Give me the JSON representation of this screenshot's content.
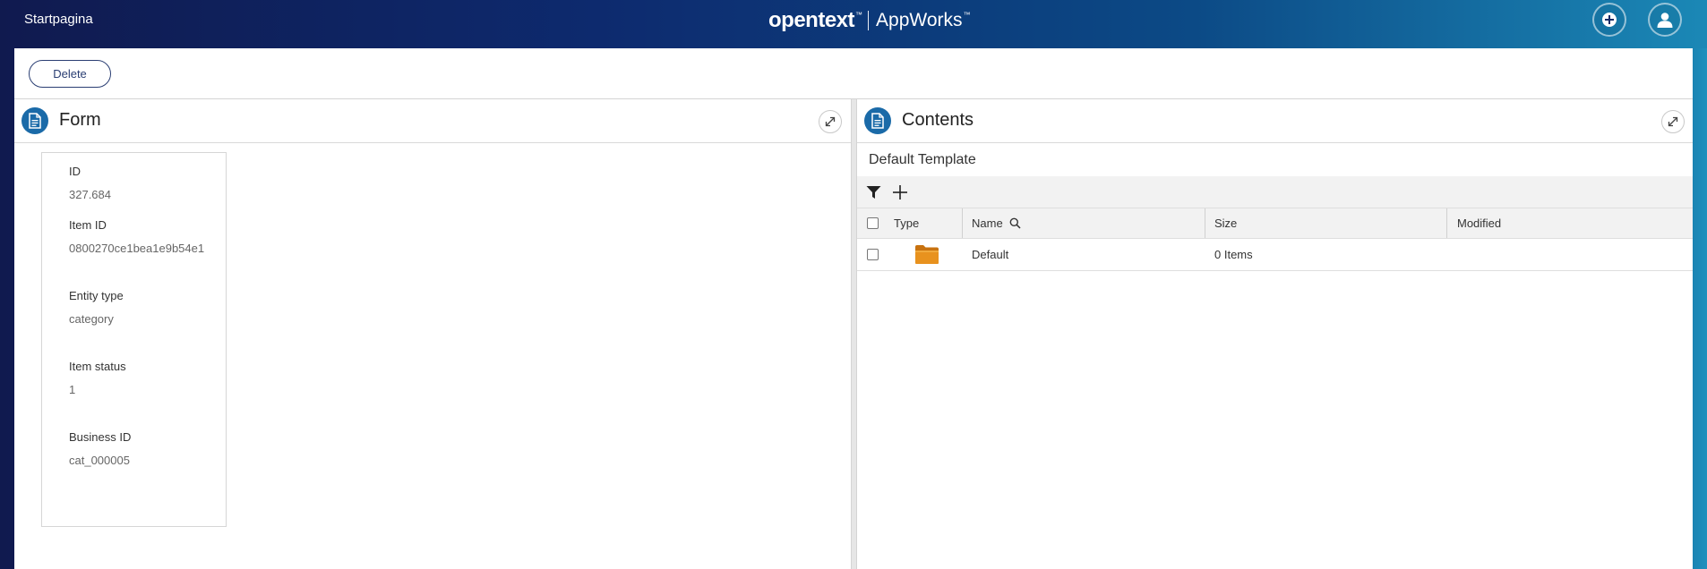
{
  "header": {
    "home_label": "Startpagina",
    "brand_company": "opentext",
    "brand_tm": "™",
    "brand_product": "AppWorks",
    "brand_product_tm": "™",
    "add_icon": "plus-circle-icon",
    "user_icon": "user-icon"
  },
  "actions": {
    "delete_label": "Delete"
  },
  "form_panel": {
    "title": "Form",
    "icon": "document-icon",
    "expand_icon": "expand-icon",
    "fields": [
      {
        "label": "ID",
        "value": "327.684"
      },
      {
        "label": "Item ID",
        "value": "0800270ce1bea1e9b54e1"
      },
      {
        "label": "Entity type",
        "value": "category"
      },
      {
        "label": "Item status",
        "value": "1"
      },
      {
        "label": "Business ID",
        "value": "cat_000005"
      }
    ]
  },
  "contents_panel": {
    "title": "Contents",
    "icon": "document-icon",
    "expand_icon": "expand-icon",
    "template_title": "Default Template",
    "toolbar": [
      "filter-icon",
      "add-icon"
    ],
    "columns": {
      "type": "Type",
      "name": "Name",
      "size": "Size",
      "modified": "Modified"
    },
    "rows": [
      {
        "type_icon": "folder-icon",
        "name": "Default",
        "size": "0 Items",
        "modified": ""
      }
    ]
  },
  "colors": {
    "header_gradient_start": "#101a4f",
    "header_gradient_end": "#1b88b6",
    "panel_icon": "#1a6aa8",
    "folder": "#e8921e",
    "button_border": "#2a3e73"
  }
}
